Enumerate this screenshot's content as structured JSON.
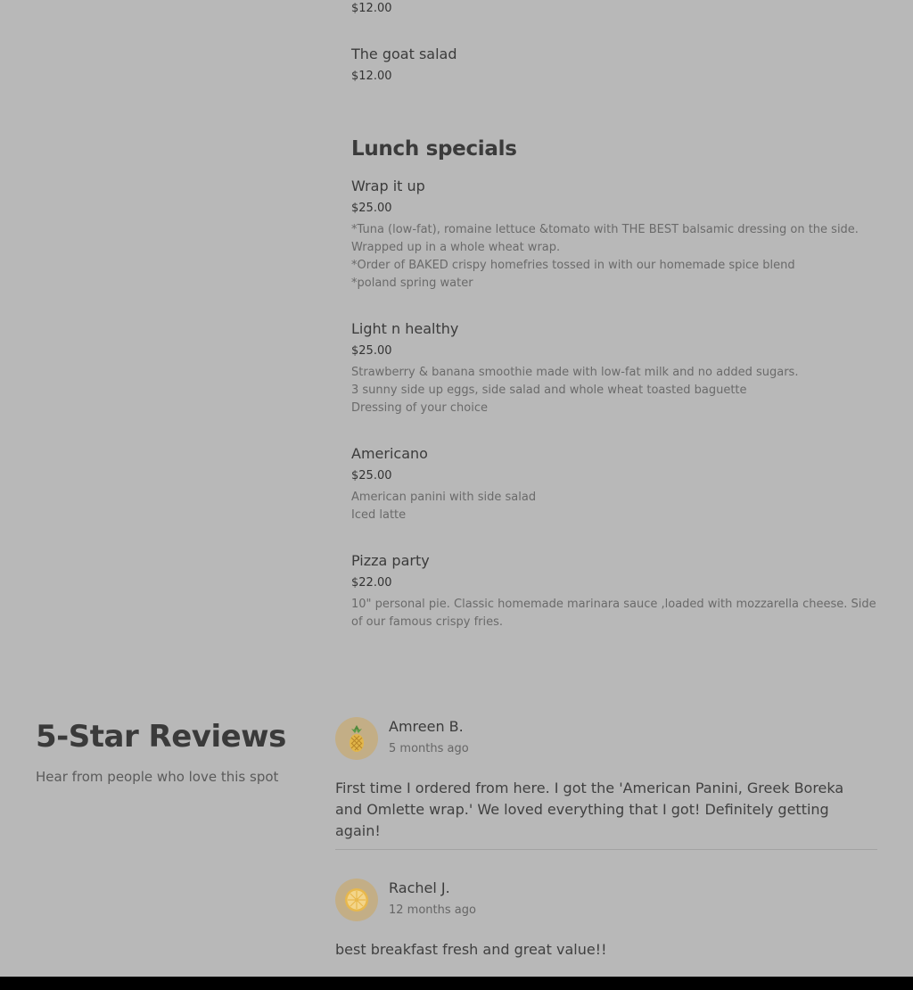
{
  "menu": {
    "top_price": "$12.00",
    "prev_item": {
      "name": "The goat salad",
      "price": "$12.00"
    },
    "section_title": "Lunch specials",
    "items": [
      {
        "name": "Wrap it up",
        "price": "$25.00",
        "desc": [
          "*Tuna (low-fat), romaine lettuce &tomato with THE BEST balsamic dressing on the side.",
          "Wrapped up in a whole wheat wrap.",
          "*Order of BAKED crispy homefries tossed in with our homemade spice blend",
          "*poland spring water"
        ]
      },
      {
        "name": "Light n healthy",
        "price": "$25.00",
        "desc": [
          "Strawberry & banana smoothie made with low-fat milk and no added sugars.",
          "3 sunny side up eggs, side salad and whole wheat toasted baguette",
          "Dressing of your choice"
        ]
      },
      {
        "name": "Americano",
        "price": "$25.00",
        "desc": [
          "American panini with side salad",
          "Iced latte"
        ]
      },
      {
        "name": "Pizza party",
        "price": "$22.00",
        "desc": [
          "10\" personal pie. Classic homemade marinara sauce ,loaded with mozzarella cheese. Side",
          "of our famous crispy fries."
        ]
      }
    ]
  },
  "reviews": {
    "title": "5-Star Reviews",
    "subtitle": "Hear from people who love this spot",
    "items": [
      {
        "name": "Amreen B.",
        "time": "5 months ago",
        "avatar_icon": "pineapple-icon",
        "text": "First time I ordered from here. I got the 'American Panini, Greek Boreka and Omlette wrap.' We loved everything that I got! Definitely getting again!"
      },
      {
        "name": "Rachel J.",
        "time": "12 months ago",
        "avatar_icon": "citrus-slice-icon",
        "text": "best breakfast fresh and great value!!"
      }
    ]
  },
  "colors": {
    "background": "#b8b8b8",
    "avatar_bg": "#c3ae86",
    "footer_bar": "#000000"
  }
}
